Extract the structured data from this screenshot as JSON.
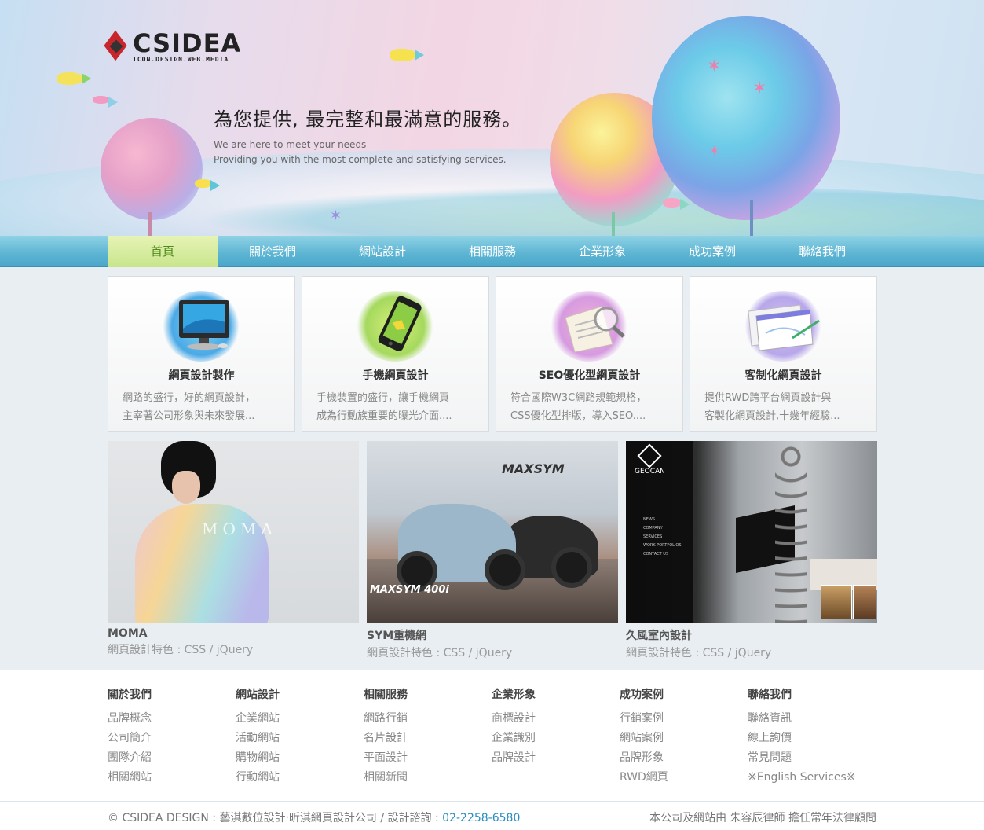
{
  "brand": {
    "name": "CSIDEA",
    "tagline": "ICON.DESIGN.WEB.MEDIA"
  },
  "hero": {
    "headline": "為您提供, 最完整和最滿意的服務。",
    "sub1": "We are here to meet your needs",
    "sub2": "Providing you with the most complete and satisfying services."
  },
  "nav": {
    "items": [
      {
        "label": "首頁",
        "active": true
      },
      {
        "label": "關於我們"
      },
      {
        "label": "網站設計"
      },
      {
        "label": "相關服務"
      },
      {
        "label": "企業形象"
      },
      {
        "label": "成功案例"
      },
      {
        "label": "聯絡我們"
      }
    ]
  },
  "services": [
    {
      "title": "網頁設計製作",
      "desc1": "網路的盛行，好的網頁設計，",
      "desc2": "主宰著公司形象與未來發展...",
      "icon": "monitor-icon"
    },
    {
      "title": "手機網頁設計",
      "desc1": "手機裝置的盛行，讓手機網頁",
      "desc2": "成為行動族重要的曝光介面....",
      "icon": "smartphone-icon"
    },
    {
      "title": "SEO優化型網頁設計",
      "desc1": "符合國際W3C網路規範規格，",
      "desc2": "CSS優化型排版，導入SEO....",
      "icon": "seo-magnifier-icon"
    },
    {
      "title": "客制化網頁設計",
      "desc1": "提供RWD跨平台網頁設計與",
      "desc2": "客製化網頁設計,十幾年經驗...",
      "icon": "browser-windows-icon"
    }
  ],
  "works": [
    {
      "title": "MOMA",
      "feature": "網頁設計特色 : CSS / jQuery",
      "image_text": "MOMA"
    },
    {
      "title": "SYM重機網",
      "feature": "網頁設計特色 : CSS / jQuery",
      "image_text": "MAXSYM 400i"
    },
    {
      "title": "久風室內設計",
      "feature": "網頁設計特色 : CSS / jQuery",
      "image_text": "GEOCAN"
    }
  ],
  "geocan_menu": [
    "NEWS",
    "COMPANY",
    "SERVICES",
    "WORK PORTFOLIOS",
    "CONTACT US"
  ],
  "footer": {
    "columns": [
      {
        "heading": "關於我們",
        "links": [
          "品牌概念",
          "公司簡介",
          "團隊介紹",
          "相關網站"
        ]
      },
      {
        "heading": "網站設計",
        "links": [
          "企業網站",
          "活動網站",
          "購物網站",
          "行動網站"
        ]
      },
      {
        "heading": "相關服務",
        "links": [
          "網路行銷",
          "名片設計",
          "平面設計",
          "相關新聞"
        ]
      },
      {
        "heading": "企業形象",
        "links": [
          "商標設計",
          "企業識別",
          "品牌設計"
        ]
      },
      {
        "heading": "成功案例",
        "links": [
          "行銷案例",
          "網站案例",
          "品牌形象",
          "RWD網頁"
        ]
      },
      {
        "heading": "聯絡我們",
        "links": [
          "聯絡資訊",
          "線上詢價",
          "常見問題",
          "※English Services※"
        ]
      }
    ],
    "copyright": "© CSIDEA DESIGN : 藝淇數位設計‧昕淇網頁設計公司 / 設計諮詢 : ",
    "phone": "02-2258-6580",
    "legal": "本公司及網站由 朱容辰律師 擔任常年法律顧問"
  },
  "colors": {
    "nav_bar": "#5fb6d4",
    "nav_active": "#c8e58c",
    "phone_link": "#2a8ec0",
    "logo_red": "#c8262c"
  }
}
